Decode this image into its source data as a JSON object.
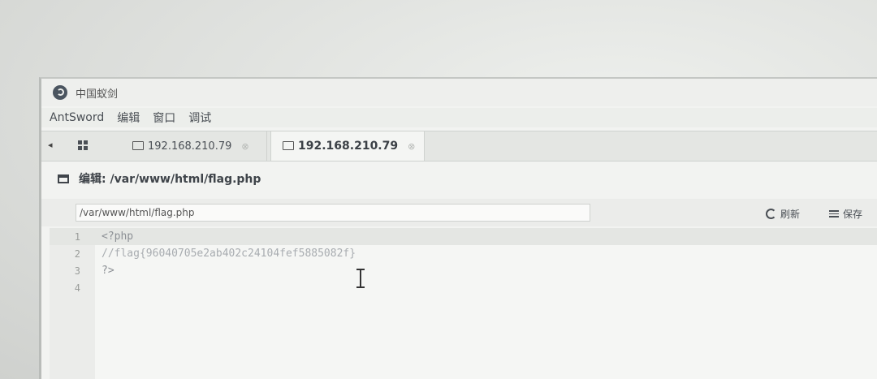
{
  "window": {
    "title": "中国蚁剑"
  },
  "menu": [
    {
      "label": "AntSword"
    },
    {
      "label": "编辑"
    },
    {
      "label": "窗口"
    },
    {
      "label": "调试"
    }
  ],
  "tabs": [
    {
      "label": "192.168.210.79",
      "active": false
    },
    {
      "label": "192.168.210.79",
      "active": true
    }
  ],
  "panel": {
    "title": "编辑: /var/www/html/flag.php",
    "path_value": "/var/www/html/flag.php",
    "refresh_label": "刷新",
    "save_label": "保存"
  },
  "editor": {
    "lines": [
      {
        "no": "1",
        "text": "<?php"
      },
      {
        "no": "2",
        "text": "//flag{96040705e2ab402c24104fef5885082f}"
      },
      {
        "no": "3",
        "text": "?>"
      },
      {
        "no": "4",
        "text": ""
      }
    ]
  }
}
